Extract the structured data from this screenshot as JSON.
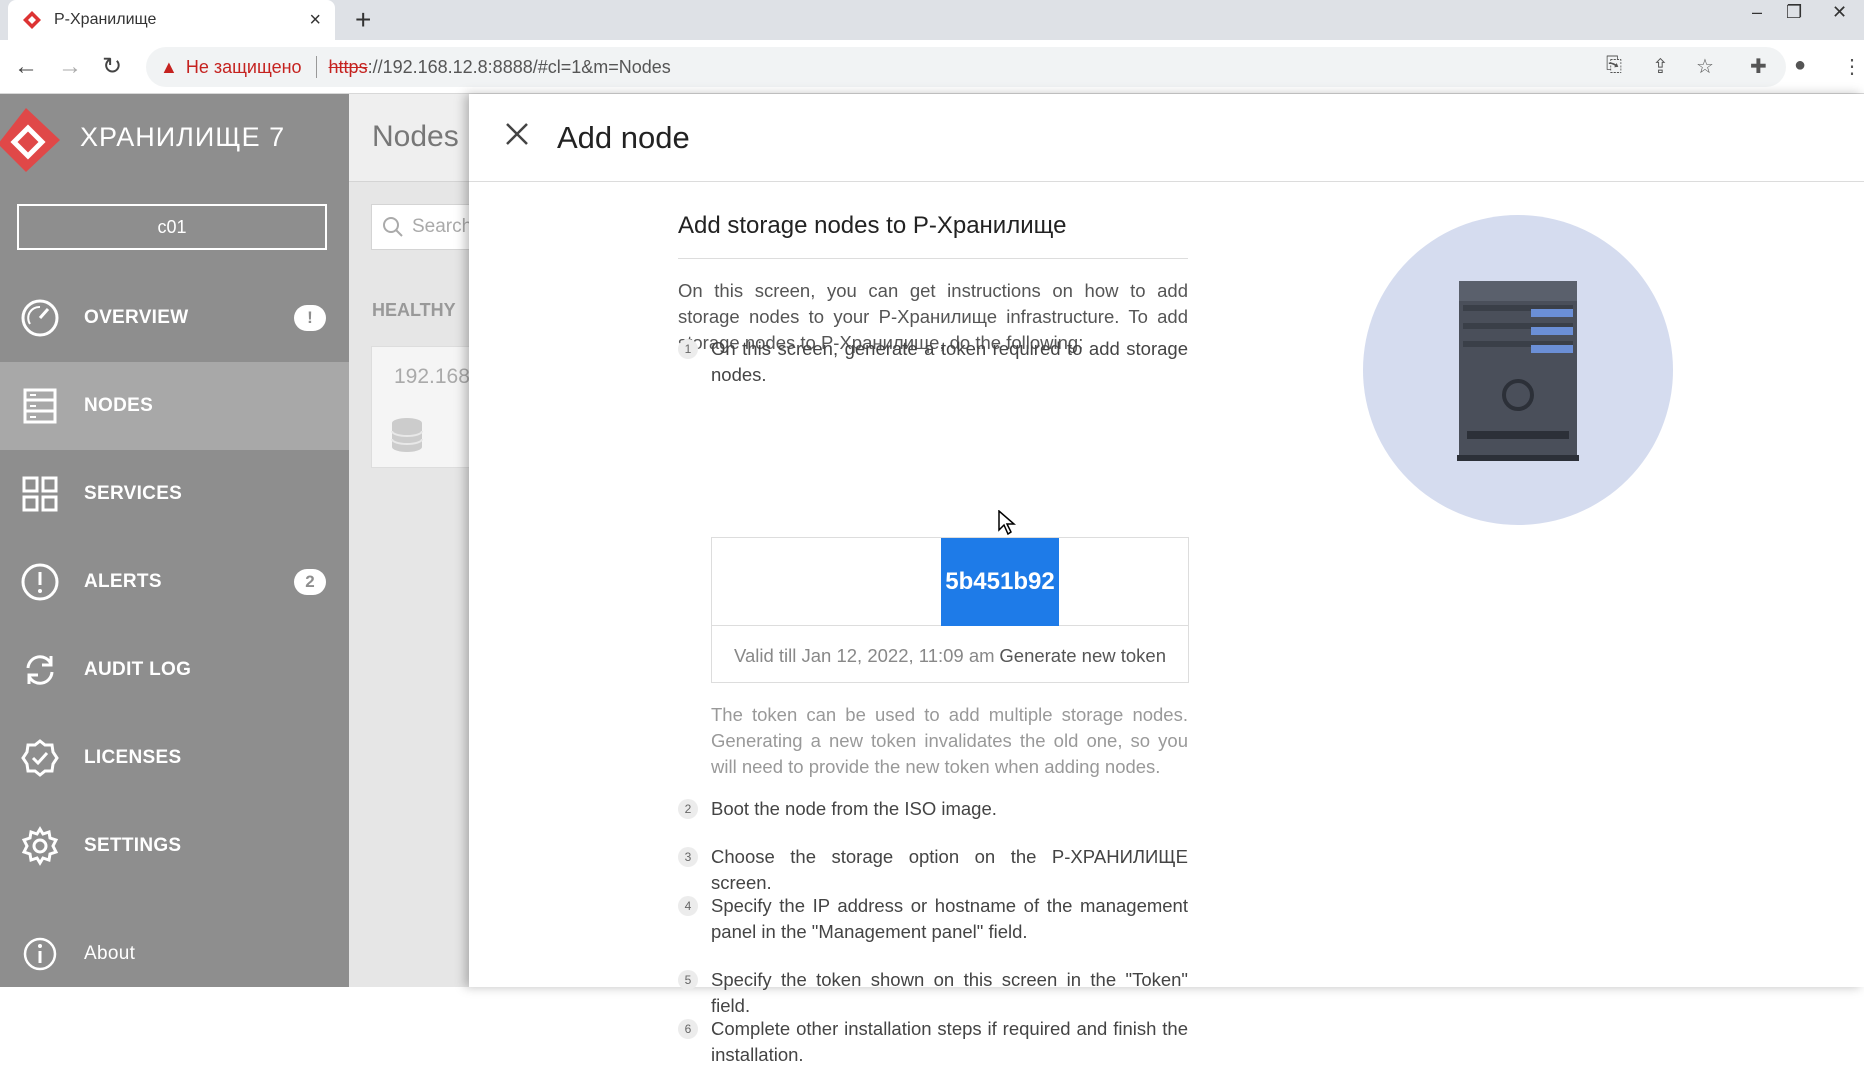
{
  "browser": {
    "tab_title": "Р-Хранилище",
    "tab_close": "×",
    "new_tab": "+",
    "address": {
      "warning_text": "Не защищено",
      "scheme": "https",
      "rest": "://192.168.12.8:8888/#cl=1&m=Nodes"
    }
  },
  "sidebar": {
    "brand": "ХРАНИЛИЩЕ 7",
    "cluster": "c01",
    "items": [
      {
        "label": "OVERVIEW",
        "badge": "!",
        "icon": "gauge-icon"
      },
      {
        "label": "NODES",
        "icon": "server-icon",
        "active": true
      },
      {
        "label": "SERVICES",
        "icon": "grid-icon"
      },
      {
        "label": "ALERTS",
        "badge": "2",
        "icon": "alert-icon"
      },
      {
        "label": "AUDIT LOG",
        "icon": "refresh-icon"
      },
      {
        "label": "LICENSES",
        "icon": "certificate-icon"
      },
      {
        "label": "SETTINGS",
        "icon": "gear-icon"
      }
    ],
    "about": "About"
  },
  "main": {
    "title": "Nodes",
    "search_placeholder": "Search",
    "section": "HEALTHY",
    "card_ip": "192.168"
  },
  "panel": {
    "title": "Add node",
    "heading": "Add storage nodes to Р-Хранилище",
    "intro": "On this screen, you can get instructions on how to add storage nodes to your Р-Хранилище infrastructure. To add storage nodes to Р-Хранилище, do the following:",
    "steps": [
      {
        "num": "1",
        "text": "On this screen, generate a token required to add storage nodes."
      },
      {
        "num": "2",
        "text": "Boot the node from the ISO image."
      },
      {
        "num": "3",
        "text": "Choose the storage option on the Р-ХРАНИЛИЩЕ screen."
      },
      {
        "num": "4",
        "text": "Specify the IP address or hostname of the management panel in the \"Management panel\" field."
      },
      {
        "num": "5",
        "text": "Specify the token shown on this screen in the \"Token\" field."
      },
      {
        "num": "6",
        "text": "Complete other installation steps if required and finish the installation."
      }
    ],
    "token": "5b451b92",
    "valid_till": "Valid till Jan 12, 2022, 11:09 am",
    "generate": "Generate new token",
    "note": "The token can be used to add multiple storage nodes. Generating a new token invalidates the old one, so you will need to provide the new token when adding nodes."
  },
  "colors": {
    "sidebar_bg": "#8e8e8e",
    "active_item_bg": "#a8a8a8",
    "token_highlight": "#1e7be8",
    "brand_red": "#e04848"
  }
}
